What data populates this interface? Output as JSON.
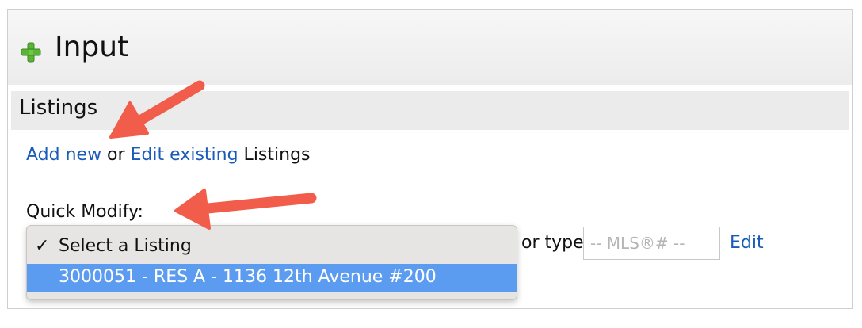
{
  "panel": {
    "title": "Input",
    "icon": "plus-icon",
    "accent_color": "#5bb435"
  },
  "section": {
    "title": "Listings"
  },
  "links": {
    "add_new": "Add new",
    "or": " or ",
    "edit_existing": "Edit existing",
    "suffix": " Listings",
    "link_color": "#1a5bb8"
  },
  "quick_modify": {
    "label": "Quick Modify:",
    "or_type": "or type",
    "mls_placeholder": "-- MLS®# --",
    "edit_label": "Edit",
    "dropdown": {
      "options": [
        {
          "check": "✓",
          "label": "Select a Listing",
          "selected": true,
          "highlighted": false
        },
        {
          "check": "",
          "label": "3000051 - RES A - 1136 12th Avenue #200",
          "selected": false,
          "highlighted": true
        }
      ],
      "highlight_color": "#5b9cf0"
    }
  },
  "annotations": {
    "arrow_color": "#f25c4a",
    "arrows": [
      "annotation-arrow-add-new",
      "annotation-arrow-quick-modify"
    ]
  }
}
